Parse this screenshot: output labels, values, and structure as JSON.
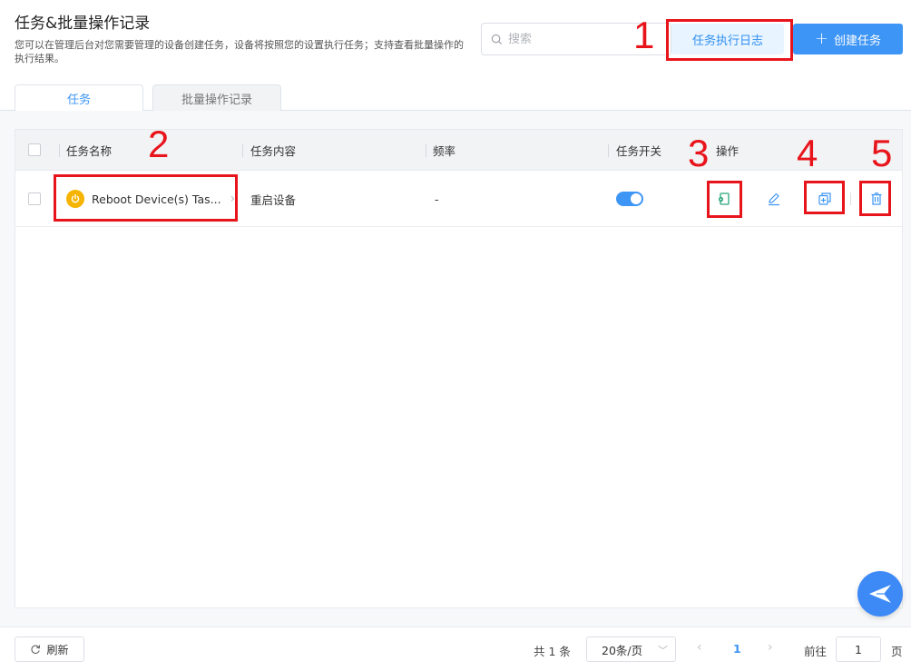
{
  "header": {
    "title": "任务&批量操作记录",
    "description": "您可以在管理后台对您需要管理的设备创建任务，设备将按照您的设置执行任务；支持查看批量操作的执行结果。"
  },
  "search": {
    "placeholder": "搜索",
    "icon": "search-icon"
  },
  "buttons": {
    "log": "任务执行日志",
    "create": "创建任务",
    "create_icon": "+"
  },
  "tabs": [
    {
      "label": "任务",
      "active": true
    },
    {
      "label": "批量操作记录",
      "active": false
    }
  ],
  "table": {
    "columns": [
      "任务名称",
      "任务内容",
      "频率",
      "任务开关",
      "操作"
    ],
    "rows": [
      {
        "name": "Reboot Device(s) Tas...",
        "content": "重启设备",
        "frequency": "-",
        "enabled": true,
        "actions": [
          "execute-icon",
          "edit-icon",
          "copy-icon",
          "delete-icon"
        ]
      }
    ]
  },
  "annotations": [
    "1",
    "2",
    "3",
    "4",
    "5"
  ],
  "footer": {
    "refresh": "刷新",
    "total": "共 1 条",
    "page_size": "20条/页",
    "current_page": "1",
    "goto_label": "前往",
    "goto_value": "1",
    "page_unit": "页"
  },
  "colors": {
    "accent": "#3d95f5",
    "annotation": "#e8141b",
    "power": "#f5b400"
  }
}
